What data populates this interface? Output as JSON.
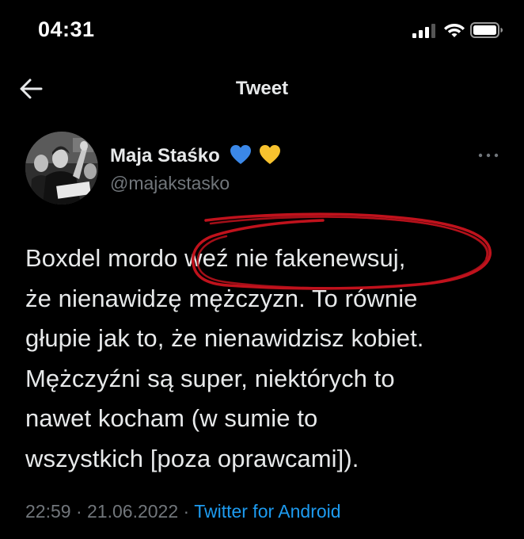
{
  "status_bar": {
    "time": "04:31",
    "icons": [
      "cellular-signal-icon",
      "wifi-icon",
      "battery-icon"
    ]
  },
  "header": {
    "back_icon": "arrow-left-icon",
    "title": "Tweet"
  },
  "tweet": {
    "author": {
      "display_name": "Maja Staśko",
      "emojis": [
        "blue-heart-icon",
        "yellow-heart-icon"
      ],
      "handle": "@majakstasko"
    },
    "more_icon": "ellipsis-icon",
    "text": "Boxdel mordo weź nie fakenewsuj,\nże nienawidzę mężczyzn. To równie\ngłupie jak to, że nienawidzisz kobiet.\nMężczyźni są super, niektórych to\nnawet kocham (w sumie to\nwszystkich [poza oprawcami]).",
    "time": "22:59",
    "separator": "·",
    "date": "21.06.2022",
    "source": "Twitter for Android"
  },
  "colors": {
    "background": "#000000",
    "text_primary": "#e7e9ea",
    "text_secondary": "#71767b",
    "link": "#1d9bf0",
    "annotation": "#c0121c"
  }
}
